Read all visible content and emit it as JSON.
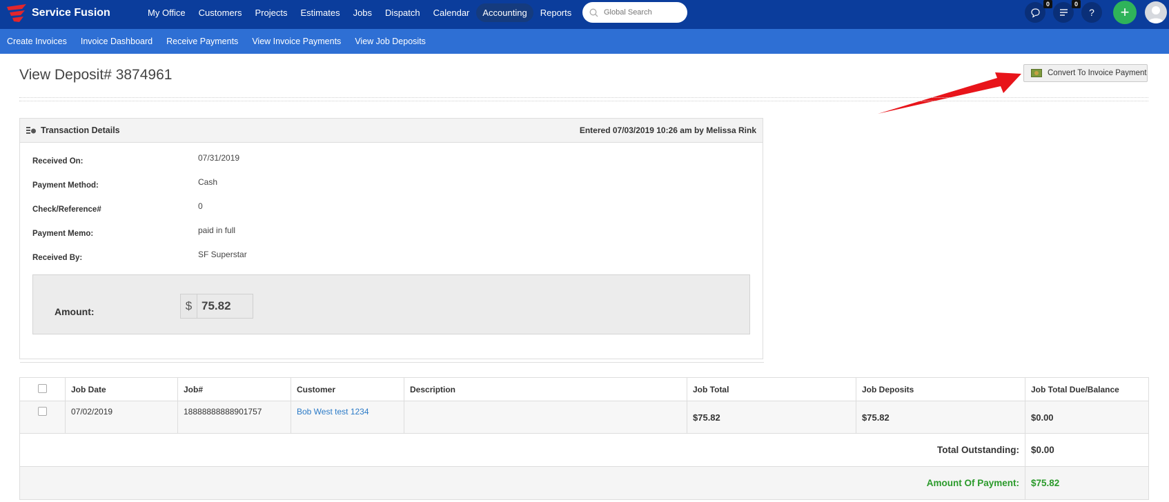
{
  "app": {
    "brand": "Service Fusion",
    "nav": [
      "My Office",
      "Customers",
      "Projects",
      "Estimates",
      "Jobs",
      "Dispatch",
      "Calendar",
      "Accounting",
      "Reports"
    ],
    "active_nav": "Accounting",
    "search_placeholder": "Global Search",
    "chat_badge": "0",
    "list_badge": "0",
    "help_label": "?",
    "plus_label": "+"
  },
  "subnav": [
    "Create Invoices",
    "Invoice Dashboard",
    "Receive Payments",
    "View Invoice Payments",
    "View Job Deposits"
  ],
  "page": {
    "title": "View Deposit# 3874961",
    "convert_button": "Convert To Invoice Payment"
  },
  "transaction": {
    "heading": "Transaction Details",
    "entered": "Entered 07/03/2019 10:26 am by Melissa Rink",
    "fields": [
      {
        "label": "Received On:",
        "value": "07/31/2019"
      },
      {
        "label": "Payment Method:",
        "value": "Cash"
      },
      {
        "label": "Check/Reference#",
        "value": "0"
      },
      {
        "label": "Payment Memo:",
        "value": "paid in full"
      },
      {
        "label": "Received By:",
        "value": "SF Superstar"
      }
    ],
    "amount_label": "Amount:",
    "currency": "$",
    "amount": "75.82"
  },
  "table": {
    "headers": [
      "Job Date",
      "Job#",
      "Customer",
      "Description",
      "Job Total",
      "Job Deposits",
      "Job Total Due/Balance"
    ],
    "rows": [
      {
        "job_date": "07/02/2019",
        "job_no": "18888888888901757",
        "customer": "Bob West test 1234",
        "description": "",
        "job_total": "$75.82",
        "job_deposits": "$75.82",
        "balance": "$0.00"
      }
    ],
    "total_outstanding_label": "Total Outstanding:",
    "total_outstanding": "$0.00",
    "amount_of_payment_label": "Amount Of Payment:",
    "amount_of_payment": "$75.82"
  },
  "colors": {
    "topbar": "#0b3d9c",
    "subbar": "#2e6fd4",
    "accent_green": "#2fb35a",
    "annotation_arrow": "#e8141a",
    "payment_text": "#2a9a2a"
  },
  "icons": [
    "service-fusion-logo",
    "search-icon",
    "chat-icon",
    "list-icon",
    "help-icon",
    "plus-icon",
    "avatar-icon",
    "cash-icon",
    "transaction-icon",
    "checkbox-icon"
  ]
}
